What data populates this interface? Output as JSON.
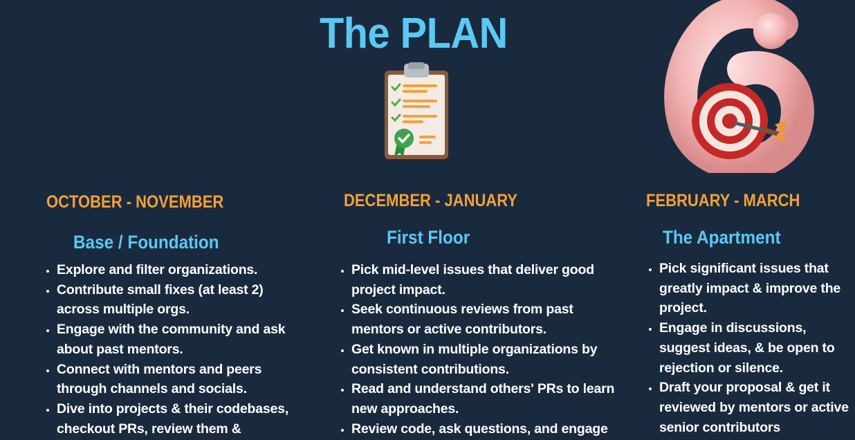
{
  "header": {
    "title": "The PLAN"
  },
  "icons": {
    "clipboard": "clipboard-checklist-icon",
    "goal": "number-six-target-icon"
  },
  "colors": {
    "background": "#1a2a3e",
    "title": "#5bc8f5",
    "period": "#f5a135",
    "text": "#ffffff"
  },
  "columns": [
    {
      "period": "OCTOBER - NOVEMBER",
      "phase": "Base / Foundation",
      "items": [
        "Explore and filter organizations.",
        "Contribute small fixes (at least 2) across multiple orgs.",
        "Engage with the community and ask about past mentors.",
        "Connect with mentors and peers through channels and socials.",
        "Dive into projects & their codebases, checkout PRs, review them &"
      ]
    },
    {
      "period": "DECEMBER - JANUARY",
      "phase": "First Floor",
      "items": [
        "Pick mid-level issues that deliver good project impact.",
        "Seek continuous reviews from past mentors or active contributors.",
        "Get known in multiple organizations by consistent contributions.",
        "Read and understand others' PRs to learn new approaches.",
        "Review code, ask questions, and engage"
      ]
    },
    {
      "period": "FEBRUARY - MARCH",
      "phase": "The Apartment",
      "items": [
        "Pick significant issues that greatly impact & improve the project.",
        "Engage in discussions, suggest ideas, & be open to rejection or silence.",
        "Draft your proposal & get it reviewed by mentors or active senior contributors"
      ]
    }
  ]
}
